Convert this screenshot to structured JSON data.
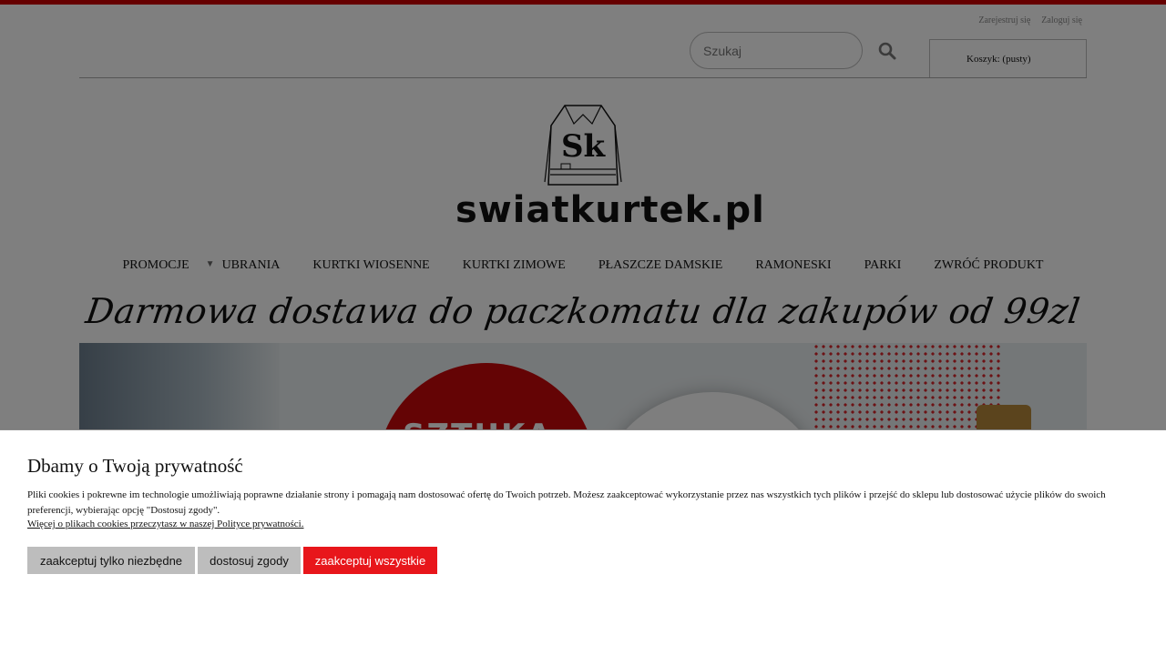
{
  "header": {
    "register_label": "Zarejestruj się",
    "login_label": "Zaloguj się",
    "search_placeholder": "Szukaj",
    "cart_label": "Koszyk: (pusty)"
  },
  "logo": {
    "monogram": "Sk",
    "wordmark": "swiatkurtek.pl"
  },
  "nav": {
    "items": [
      {
        "label": "PROMOCJE"
      },
      {
        "label": "UBRANIA"
      },
      {
        "label": "KURTKI WIOSENNE"
      },
      {
        "label": "KURTKI ZIMOWE"
      },
      {
        "label": "PŁASZCZE DAMSKIE"
      },
      {
        "label": "RAMONESKI"
      },
      {
        "label": "PARKI"
      },
      {
        "label": "ZWRÓĆ PRODUKT"
      }
    ]
  },
  "promo": {
    "text": "Darmowa dostawa do paczkomatu dla zakupów od 99zl"
  },
  "banner": {
    "badge_text": "SZTUKA"
  },
  "cookie": {
    "title": "Dbamy o Twoją prywatność",
    "description": "Pliki cookies i pokrewne im technologie umożliwiają poprawne działanie strony i pomagają nam dostosować ofertę do Twoich potrzeb. Możesz zaakceptować wykorzystanie przez nas wszystkich tych plików i przejść do sklepu lub dostosować użycie plików do swoich preferencji, wybierając opcję \"Dostosuj zgody\".",
    "policy_link": "Więcej o plikach cookies przeczytasz w naszej Polityce prywatności.",
    "btn_necessary": "zaakceptuj tylko niezbędne",
    "btn_customize": "dostosuj zgody",
    "btn_accept_all": "zaakceptuj wszystkie"
  },
  "colors": {
    "brand_red": "#e8161b",
    "topbar_red": "#cc0000"
  }
}
